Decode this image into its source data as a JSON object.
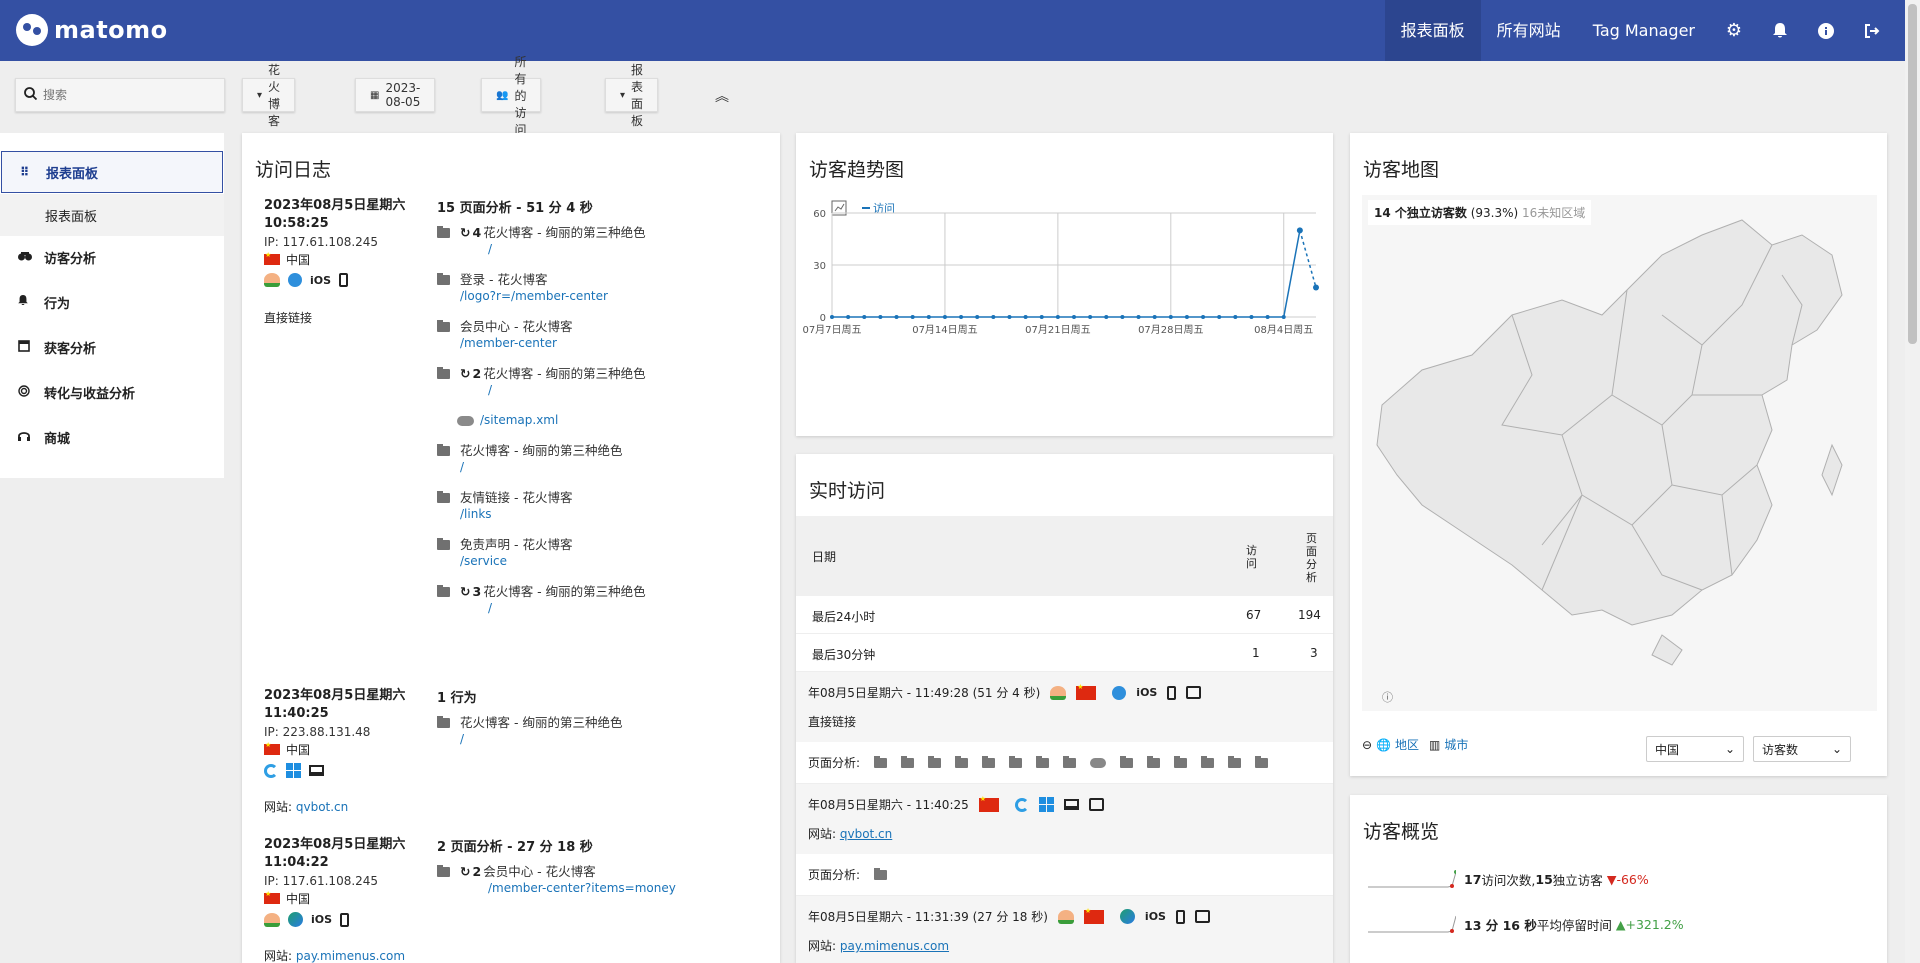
{
  "brand": "matomo",
  "topnav": {
    "dashboard": "报表面板",
    "all_sites": "所有网站",
    "tag_manager": "Tag Manager"
  },
  "toolbar": {
    "search_placeholder": "搜索",
    "site": "花火博客",
    "date": "2023-08-05",
    "segment": "所有的访问",
    "dashboard": "报表面板"
  },
  "sidebar": {
    "items": [
      {
        "label": "报表面板",
        "icon": "grid-icon"
      },
      {
        "label": "报表面板",
        "sub": true
      },
      {
        "label": "访客分析",
        "icon": "binoculars-icon"
      },
      {
        "label": "行为",
        "icon": "bell-icon"
      },
      {
        "label": "获客分析",
        "icon": "funnel-icon"
      },
      {
        "label": "转化与收益分析",
        "icon": "target-icon"
      },
      {
        "label": "商城",
        "icon": "headset-icon"
      }
    ]
  },
  "visitlog": {
    "title": "访问日志",
    "visits": [
      {
        "date": "2023年08月5日星期六",
        "time": "10:58:25",
        "ip": "IP: 117.61.108.245",
        "country": "中国",
        "os": "iOS",
        "referrer": "直接链接",
        "summary": "15 页面分析 - 51 分 4 秒",
        "actions": [
          {
            "repeat": "4",
            "title": "花火博客 - 绚丽的第三种绝色",
            "url": "/"
          },
          {
            "title": "登录 - 花火博客",
            "url": "/logo?r=/member-center"
          },
          {
            "title": "会员中心 - 花火博客",
            "url": "/member-center"
          },
          {
            "repeat": "2",
            "title": "花火博客 - 绚丽的第三种绝色",
            "url": "/"
          },
          {
            "download": true,
            "url": "/sitemap.xml"
          },
          {
            "title": "花火博客 - 绚丽的第三种绝色",
            "url": "/"
          },
          {
            "title": "友情链接 - 花火博客",
            "url": "/links"
          },
          {
            "title": "免责声明 - 花火博客",
            "url": "/service"
          },
          {
            "repeat": "3",
            "title": "花火博客 - 绚丽的第三种绝色",
            "url": "/"
          }
        ]
      },
      {
        "date": "2023年08月5日星期六",
        "time": "11:40:25",
        "ip": "IP: 223.88.131.48",
        "country": "中国",
        "referrer_label": "网站: ",
        "referrer_link": "qvbot.cn",
        "summary": "1 行为",
        "actions": [
          {
            "title": "花火博客 - 绚丽的第三种绝色",
            "url": "/"
          }
        ]
      },
      {
        "date": "2023年08月5日星期六",
        "time": "11:04:22",
        "ip": "IP: 117.61.108.245",
        "country": "中国",
        "os": "iOS",
        "referrer_label": "网站: ",
        "referrer_link": "pay.mimenus.com",
        "summary": "2 页面分析 - 27 分 18 秒",
        "actions": [
          {
            "repeat": "2",
            "title": "会员中心 - 花火博客",
            "url": "/member-center?items=money"
          }
        ]
      }
    ]
  },
  "trend": {
    "title": "访客趋势图",
    "legend": "访问"
  },
  "chart_data": {
    "type": "line",
    "series": [
      {
        "name": "访问",
        "values": [
          0,
          0,
          0,
          0,
          0,
          0,
          0,
          0,
          0,
          0,
          0,
          0,
          0,
          0,
          0,
          0,
          0,
          0,
          0,
          0,
          0,
          0,
          0,
          0,
          0,
          0,
          0,
          0,
          0,
          50,
          17
        ]
      }
    ],
    "x_tick_labels": [
      "07月7日周五",
      "07月14日周五",
      "07月21日周五",
      "07月28日周五",
      "08月4日周五"
    ],
    "y_ticks": [
      0,
      30,
      60
    ],
    "ylim": [
      0,
      60
    ],
    "last_point_partial": true,
    "grid": true,
    "color": "#1a73b8"
  },
  "realtime": {
    "title": "实时访问",
    "col_date": "日期",
    "col_visits": "访问",
    "col_pages": "页面分析",
    "rows": [
      {
        "label": "最后24小时",
        "visits": "67",
        "pages": "194"
      },
      {
        "label": "最后30分钟",
        "visits": "1",
        "pages": "3"
      }
    ],
    "visits": [
      {
        "time": "年08月5日星期六 - 11:49:28 (51 分 4 秒)",
        "os": "iOS",
        "ref": "直接链接",
        "pages_label": "页面分析:"
      },
      {
        "time": "年08月5日星期六 - 11:40:25",
        "ref_label": "网站: ",
        "ref_link": "qvbot.cn",
        "pages_label": "页面分析:"
      },
      {
        "time": "年08月5日星期六 - 11:31:39 (27 分 18 秒)",
        "os": "iOS",
        "ref_label": "网站: ",
        "ref_link": "pay.mimenus.com"
      }
    ]
  },
  "map": {
    "title": "访客地图",
    "summary_strong": "14 个独立访客数",
    "summary_pct": " (93.3%)",
    "summary_unknown": " 16未知区域",
    "link_region": "地区",
    "link_city": "城市",
    "select_country": "中国",
    "select_metric": "访客数"
  },
  "overview": {
    "title": "访客概览",
    "rows": [
      {
        "value": "17",
        "text": " 访问次数, ",
        "value2": "15",
        "text2": " 独立访客",
        "change": "-66%",
        "trend": "down"
      },
      {
        "value": "13 分 16 秒",
        "text": " 平均停留时间",
        "change": "+321.2%",
        "trend": "up"
      }
    ]
  }
}
